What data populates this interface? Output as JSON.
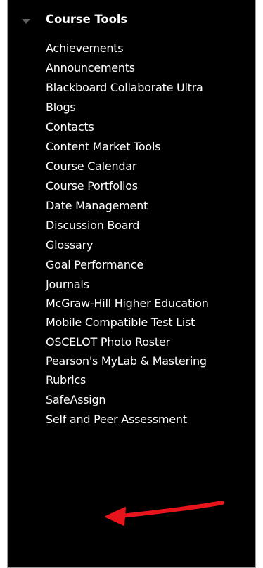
{
  "section": {
    "title": "Course Tools",
    "toggle_icon": "triangle-down-icon"
  },
  "tools": [
    {
      "label": "Achievements"
    },
    {
      "label": "Announcements"
    },
    {
      "label": "Blackboard Collaborate Ultra"
    },
    {
      "label": "Blogs"
    },
    {
      "label": "Contacts"
    },
    {
      "label": "Content Market Tools"
    },
    {
      "label": "Course Calendar"
    },
    {
      "label": "Course Portfolios"
    },
    {
      "label": "Date Management"
    },
    {
      "label": "Discussion Board"
    },
    {
      "label": "Glossary"
    },
    {
      "label": "Goal Performance"
    },
    {
      "label": "Journals"
    },
    {
      "label": "McGraw-Hill Higher Education"
    },
    {
      "label": "Mobile Compatible Test List"
    },
    {
      "label": "OSCELOT Photo Roster"
    },
    {
      "label": "Pearson's MyLab & Mastering"
    },
    {
      "label": "Rubrics"
    },
    {
      "label": "SafeAssign"
    },
    {
      "label": "Self and Peer Assessment"
    }
  ],
  "annotation": {
    "pointer_icon": "red-arrow-icon",
    "color": "#e8141b"
  },
  "colors": {
    "panel_bg": "#000000",
    "text": "#ffffff",
    "toggle": "#5e5e5e"
  }
}
